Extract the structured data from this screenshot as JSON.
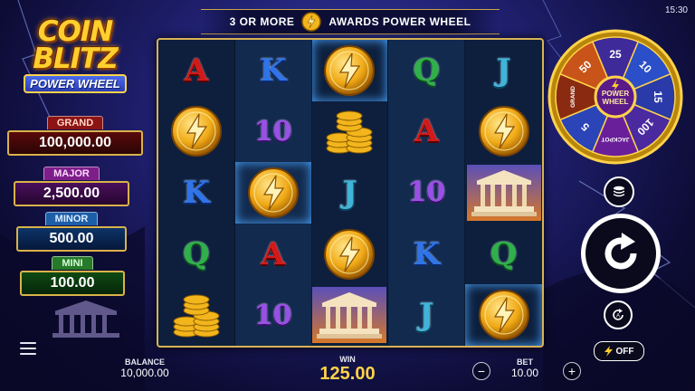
{
  "status_bar": {
    "time": "15:30"
  },
  "logo": {
    "title": "COIN\nBLITZ",
    "subtitle": "POWER WHEEL"
  },
  "banner": {
    "left_text": "3 OR MORE",
    "right_text": "AWARDS POWER WHEEL"
  },
  "jackpots": [
    {
      "label": "GRAND",
      "value": "100,000.00"
    },
    {
      "label": "MAJOR",
      "value": "2,500.00"
    },
    {
      "label": "MINOR",
      "value": "500.00"
    },
    {
      "label": "MINI",
      "value": "100.00"
    }
  ],
  "reels": [
    [
      "A",
      "K",
      "coin",
      "Q",
      "J"
    ],
    [
      "coin",
      "10",
      "coins-stack",
      "A",
      "coin"
    ],
    [
      "K",
      "coin",
      "J",
      "10",
      "temple"
    ],
    [
      "Q",
      "A",
      "coin",
      "K",
      "Q"
    ],
    [
      "coins-stack",
      "10",
      "temple",
      "J",
      "coin"
    ]
  ],
  "highlighted_coins": [
    [
      0,
      2
    ],
    [
      2,
      1
    ],
    [
      4,
      4
    ]
  ],
  "power_wheel": {
    "center_label": "POWER WHEEL",
    "segments": [
      "25",
      "10",
      "15",
      "100",
      "JACKPOT",
      "5",
      "GRAND",
      "50"
    ]
  },
  "turbo": {
    "label": "OFF"
  },
  "footer": {
    "balance_label": "BALANCE",
    "balance_value": "10,000.00",
    "win_label": "WIN",
    "win_value": "125.00",
    "bet_label": "BET",
    "bet_value": "10.00",
    "minus": "−",
    "plus": "+"
  },
  "colors": {
    "gold": "#d8b354",
    "win_gold": "#ffd34a",
    "grand": "#8c1414",
    "major": "#7d1e8a",
    "minor": "#1d5ea8",
    "mini": "#267a2a"
  },
  "icons": [
    "lightning-bolt-icon",
    "coin-stack-icon",
    "spin-icon",
    "autoplay-icon",
    "menu-icon"
  ]
}
